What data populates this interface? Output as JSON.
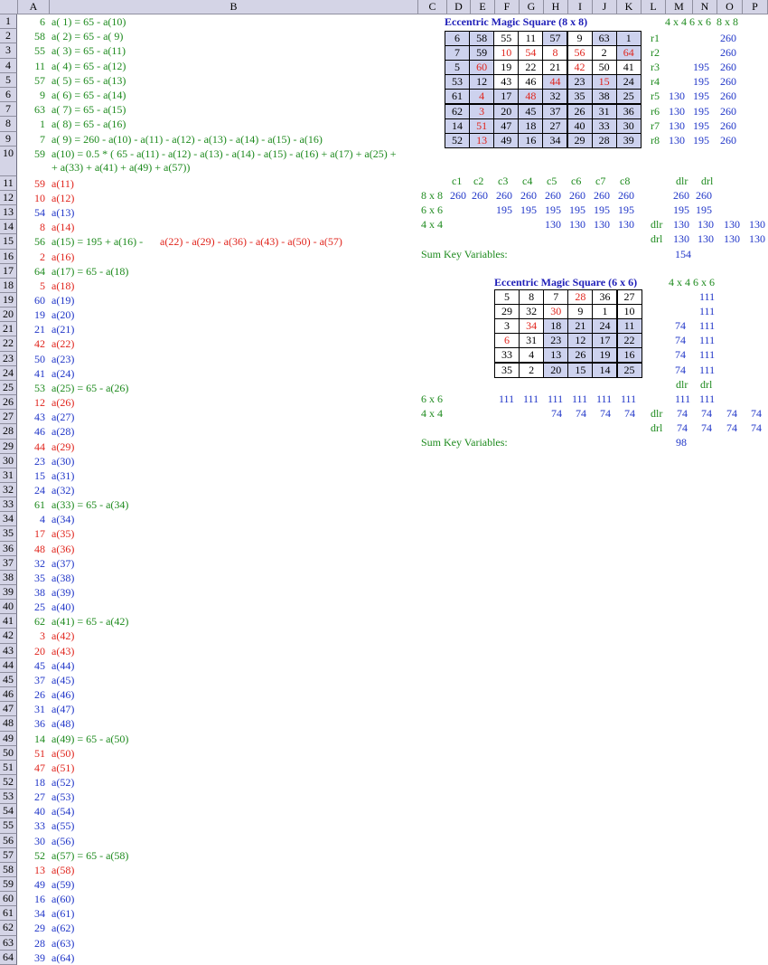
{
  "columns": [
    "A",
    "B",
    "C",
    "D",
    "E",
    "F",
    "G",
    "H",
    "I",
    "J",
    "K",
    "L",
    "M",
    "N",
    "O",
    "P"
  ],
  "colA": [
    6,
    58,
    55,
    11,
    57,
    9,
    63,
    1,
    7,
    59,
    10,
    54,
    8,
    56,
    2,
    64,
    5,
    60,
    19,
    21,
    42,
    50,
    41,
    53,
    12,
    43,
    46,
    44,
    23,
    15,
    24,
    61,
    4,
    17,
    48,
    32,
    35,
    38,
    25,
    62,
    3,
    20,
    45,
    37,
    26,
    31,
    36,
    14,
    51,
    47,
    18,
    27,
    40,
    33,
    30,
    52,
    13,
    49,
    16,
    34,
    29,
    28,
    39
  ],
  "colA_row10": 59,
  "colB_extra": {
    "r1": "a( 1) = 65 - a(10)",
    "r2": "a( 2) = 65 - a( 9)",
    "r3": "a( 3) = 65 - a(11)",
    "r4": "a( 4) = 65 - a(12)",
    "r5": "a( 5) = 65 - a(13)",
    "r6": "a( 6) = 65 - a(14)",
    "r7": "a( 7) = 65 - a(15)",
    "r8": "a( 8) = 65 - a(16)",
    "r9": "a( 9) = 260 - a(10) - a(11) - a(12) - a(13) - a(14) - a(15) - a(16)",
    "r10a": "a(10) = 0.5 * ( 65 - a(11) - a(12) - a(13) - a(14) - a(15) - a(16) + a(17) + a(25) +",
    "r10b": "+ a(33) + a(41) + a(49) + a(57))",
    "r15": "a(15) = 195 + a(16) - ",
    "r15red": "a(22) - a(29) - a(36) - a(43) - a(50) - a(57)",
    "r17": "a(17) = 65 - a(18)",
    "r25": "a(25) = 65 - a(26)",
    "r33": "a(33) = 65 - a(34)",
    "r41": "a(41) = 65 - a(42)",
    "r49": "a(49) = 65 - a(50)",
    "r57": "a(57) = 65 - a(58)"
  },
  "sq8": {
    "title": "Eccentric Magic Square (8 x 8)",
    "grid": [
      [
        6,
        58,
        55,
        11,
        57,
        9,
        63,
        1
      ],
      [
        7,
        59,
        10,
        54,
        8,
        56,
        2,
        64
      ],
      [
        5,
        60,
        19,
        22,
        21,
        42,
        50,
        41
      ],
      [
        53,
        12,
        43,
        46,
        44,
        23,
        15,
        24
      ],
      [
        61,
        4,
        17,
        48,
        32,
        35,
        38,
        25
      ],
      [
        62,
        3,
        20,
        45,
        37,
        26,
        31,
        36
      ],
      [
        14,
        51,
        47,
        18,
        27,
        40,
        33,
        30
      ],
      [
        52,
        13,
        49,
        16,
        34,
        29,
        28,
        39
      ]
    ],
    "row_labels": [
      "r1",
      "r2",
      "r3",
      "r4",
      "r5",
      "r6",
      "r7",
      "r8"
    ],
    "hdr": [
      "4 x 4",
      "6 x 6",
      "8 x 8"
    ],
    "sums": [
      [
        "",
        "",
        "260"
      ],
      [
        "",
        "",
        "260"
      ],
      [
        "",
        "195",
        "260"
      ],
      [
        "",
        "195",
        "260"
      ],
      [
        "130",
        "195",
        "260"
      ],
      [
        "130",
        "195",
        "260"
      ],
      [
        "130",
        "195",
        "260"
      ],
      [
        "130",
        "195",
        "260"
      ]
    ],
    "col_labels": [
      "c1",
      "c2",
      "c3",
      "c4",
      "c5",
      "c6",
      "c7",
      "c8"
    ],
    "diag_hdr": [
      "dlr",
      "drl"
    ],
    "row88": {
      "label": "8 x 8",
      "vals": [
        "260",
        "260",
        "260",
        "260",
        "260",
        "260",
        "260",
        "260"
      ],
      "d": [
        "260",
        "260"
      ]
    },
    "row66": {
      "label": "6 x 6",
      "vals": [
        "",
        "",
        "195",
        "195",
        "195",
        "195",
        "195",
        "195"
      ],
      "d": [
        "195",
        "195"
      ]
    },
    "row44": {
      "label": "4 x 4",
      "vals": [
        "",
        "",
        "",
        "",
        "130",
        "130",
        "130",
        "130"
      ]
    },
    "dlr_row": {
      "label": "dlr",
      "vals": [
        "130",
        "130",
        "130",
        "130"
      ]
    },
    "drl_row": {
      "label": "drl",
      "vals": [
        "130",
        "130",
        "130",
        "130"
      ]
    },
    "sumkey_label": "Sum Key Variables:",
    "sumkey": "154"
  },
  "sq6": {
    "title": "Eccentric Magic Square (6 x 6)",
    "grid": [
      [
        5,
        8,
        7,
        28,
        36,
        27
      ],
      [
        29,
        32,
        30,
        9,
        1,
        10
      ],
      [
        3,
        34,
        18,
        21,
        24,
        11
      ],
      [
        6,
        31,
        23,
        12,
        17,
        22
      ],
      [
        33,
        4,
        13,
        26,
        19,
        16
      ],
      [
        35,
        2,
        20,
        15,
        14,
        25
      ]
    ],
    "hdr": [
      "4 x 4",
      "6 x 6"
    ],
    "sums": [
      [
        "",
        "111"
      ],
      [
        "",
        "111"
      ],
      [
        "74",
        "111"
      ],
      [
        "74",
        "111"
      ],
      [
        "74",
        "111"
      ],
      [
        "74",
        "111"
      ]
    ],
    "diag_hdr": [
      "dlr",
      "drl"
    ],
    "row66": {
      "label": "6 x 6",
      "vals": [
        "111",
        "111",
        "111",
        "111",
        "111",
        "111"
      ],
      "d": [
        "111",
        "111"
      ]
    },
    "row44": {
      "label": "4 x 4",
      "vals": [
        "74",
        "74",
        "74",
        "74"
      ]
    },
    "dlr_row": {
      "label": "dlr",
      "vals": [
        "74",
        "74",
        "74",
        "74"
      ]
    },
    "drl_row": {
      "label": "drl",
      "vals": [
        "74",
        "74",
        "74",
        "74"
      ]
    },
    "sumkey_label": "Sum Key Variables:",
    "sumkey": "98"
  },
  "colors": {
    "blue": "#1f35c8",
    "red": "#e0241c",
    "green": "#1d8a1d",
    "header": "#d4d4e6",
    "shade": "#cdd2ee"
  }
}
